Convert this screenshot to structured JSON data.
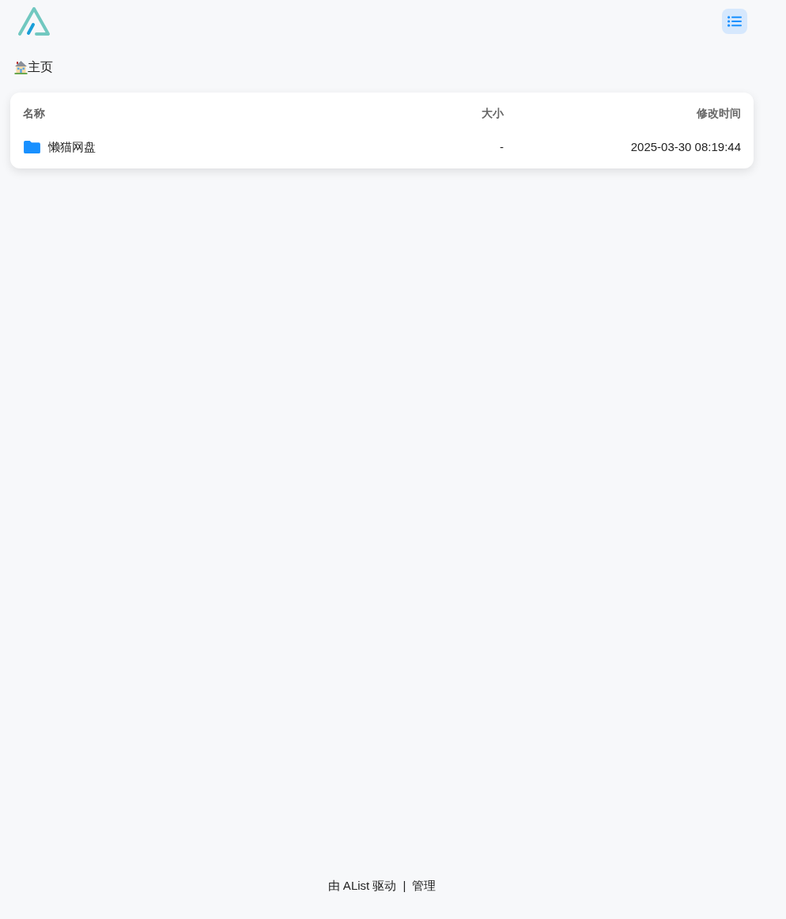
{
  "breadcrumb": [
    {
      "label": "主页"
    }
  ],
  "table": {
    "columns": [
      "名称",
      "大小",
      "修改时间"
    ],
    "rows": [
      {
        "kind": "folder",
        "name": "懒猫网盘",
        "size": "-",
        "modified": "2025-03-30 08:19:44"
      }
    ]
  },
  "footer": {
    "powered_by": "由 AList 驱动",
    "separator": "|",
    "manage_link": "管理"
  }
}
